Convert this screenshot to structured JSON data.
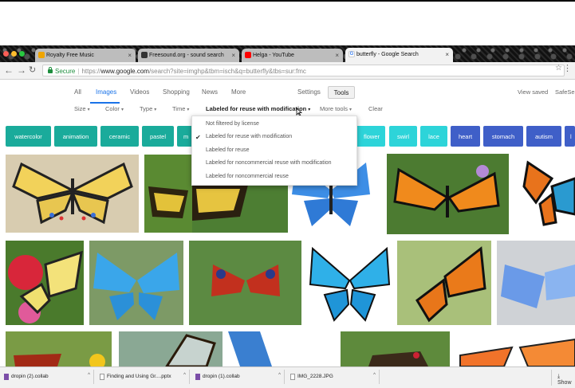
{
  "browser": {
    "tabs": [
      {
        "label": "Royalty Free Music",
        "favicon_color": "#f0a500"
      },
      {
        "label": "Freesound.org - sound search",
        "favicon_color": "#333333"
      },
      {
        "label": "Helga - YouTube",
        "favicon_color": "#ff0000"
      },
      {
        "label": "butterfly - Google Search",
        "favicon_color": "#4285f4"
      }
    ],
    "omnibox": {
      "secure_label": "Secure",
      "url_scheme": "https://",
      "url_host": "www.google.com",
      "url_rest": "/search?site=imghp&tbm=isch&q=butterfly&tbs=sur:fmc"
    }
  },
  "search_nav": {
    "tabs": [
      "All",
      "Images",
      "Videos",
      "Shopping",
      "News",
      "More"
    ],
    "active_tab": "Images",
    "settings_label": "Settings",
    "tools_label": "Tools",
    "view_saved_label": "View saved",
    "safesearch_label": "SafeSe"
  },
  "filters": {
    "size": "Size",
    "color": "Color",
    "type": "Type",
    "time": "Time",
    "usage_rights": "Labeled for reuse with modification",
    "more_tools": "More tools",
    "clear": "Clear"
  },
  "usage_menu": {
    "items": [
      "Not filtered by license",
      "Labeled for reuse with modification",
      "Labeled for reuse",
      "Labeled for noncommercial reuse with modification",
      "Labeled for noncommercial reuse"
    ],
    "selected_index": 1
  },
  "chips": [
    {
      "label": "watercolor",
      "color": "#1aab9b"
    },
    {
      "label": "animation",
      "color": "#1aab9b"
    },
    {
      "label": "ceramic",
      "color": "#1aab9b"
    },
    {
      "label": "pastel",
      "color": "#1aab9b"
    },
    {
      "label": "m",
      "color": "#1aab9b"
    },
    {
      "label": "flower",
      "color": "#2dd4d9"
    },
    {
      "label": "swirl",
      "color": "#2dd4d9"
    },
    {
      "label": "lace",
      "color": "#2dd4d9"
    },
    {
      "label": "heart",
      "color": "#3f5fc8"
    },
    {
      "label": "stomach",
      "color": "#3f5fc8"
    },
    {
      "label": "autism",
      "color": "#3f5fc8"
    },
    {
      "label": "l",
      "color": "#3f5fc8"
    }
  ],
  "downloads": {
    "items": [
      "dropin (2).collab",
      "Finding and Using Gr....pptx",
      "dropin (1).collab",
      "IMG_2228.JPG"
    ],
    "show_all_label": "Show"
  }
}
